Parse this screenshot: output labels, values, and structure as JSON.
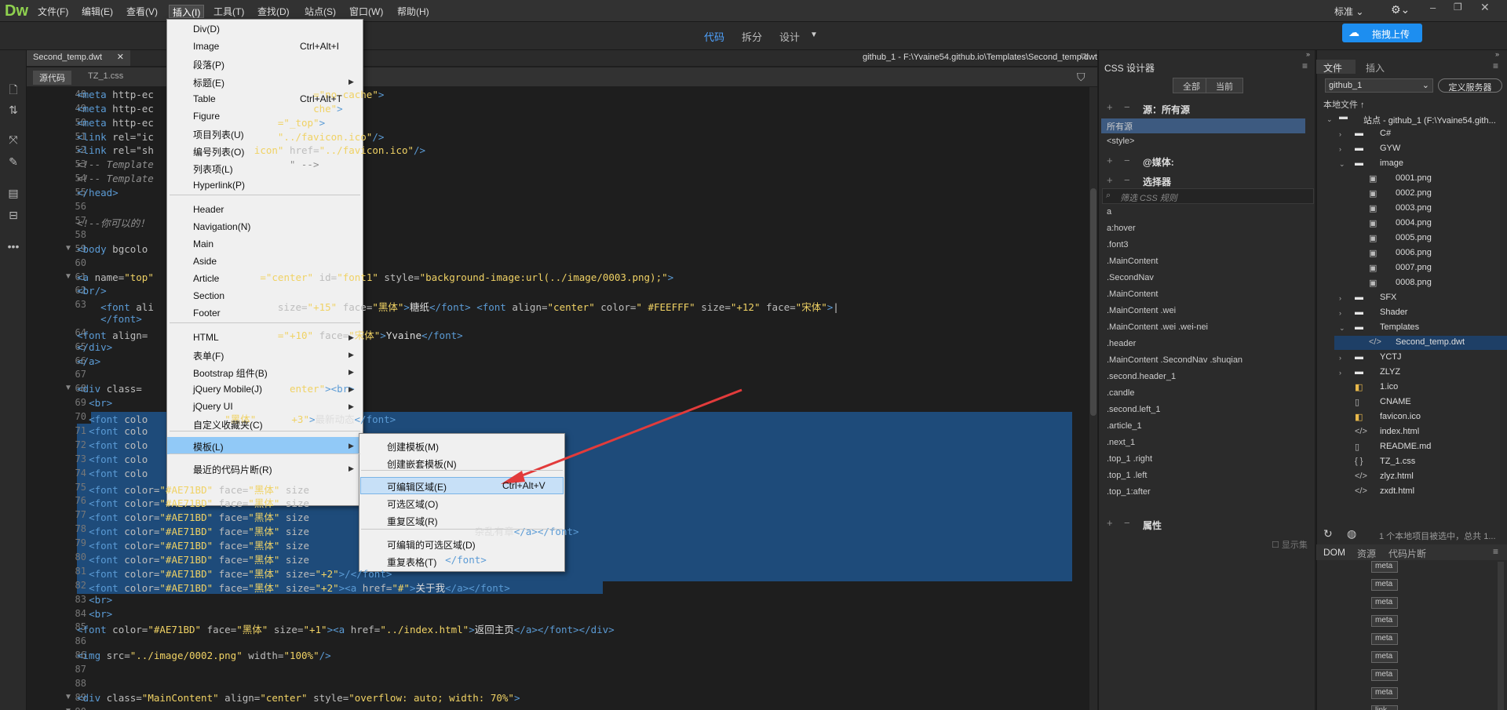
{
  "app": {
    "logo": "Dw",
    "standard": "标准",
    "upload": "拖拽上传"
  },
  "menubar": [
    "文件(F)",
    "编辑(E)",
    "查看(V)",
    "插入(I)",
    "工具(T)",
    "查找(D)",
    "站点(S)",
    "窗口(W)",
    "帮助(H)"
  ],
  "viewtabs": [
    "代码",
    "拆分",
    "设计"
  ],
  "doc": {
    "tab": "Second_temp.dwt",
    "path": "github_1 - F:\\Yvaine54.github.io\\Templates\\Second_temp.dwt",
    "subtabs": [
      "源代码",
      "TZ_1.css"
    ]
  },
  "code_lines": [
    {
      "n": "48",
      "fold": "",
      "html": "<span class=t>&lt;meta</span> <span class=a>http-ec</span><span class=a>                           </span><span class=s>=\"no-cache\"</span><span class=t>&gt;</span>"
    },
    {
      "n": "49",
      "fold": "",
      "html": "<span class=t>&lt;meta</span> <span class=a>http-ec</span><span class=a>                           </span><span class=s>che\"</span><span class=t>&gt;</span>"
    },
    {
      "n": "50",
      "fold": "",
      "html": "<span class=t>&lt;meta</span> <span class=a>http-ec</span><span class=a>                     </span><span class=s>=\"_top\"</span><span class=t>&gt;</span>"
    },
    {
      "n": "51",
      "fold": "",
      "html": "<span class=t>&lt;link</span> <span class=a>rel=\"ic</span><span class=a>                     </span><span class=s>\"../favicon.ico\"</span><span class=t>/&gt;</span>"
    },
    {
      "n": "52",
      "fold": "",
      "html": "<span class=t>&lt;link</span> <span class=a>rel=\"sh</span><span class=a>                 </span><span class=s>icon\"</span> <span class=a>href=</span><span class=s>\"../favicon.ico\"</span><span class=t>/&gt;</span>"
    },
    {
      "n": "53",
      "fold": "",
      "html": "<span class=c>&lt;!-- Template</span><span class=c>                       \" --&gt;</span>"
    },
    {
      "n": "54",
      "fold": "",
      "html": "<span class=c>&lt;!-- Template</span>"
    },
    {
      "n": "55",
      "fold": "",
      "html": "<span class=t>&lt;/head&gt;</span>"
    },
    {
      "n": "56",
      "fold": "",
      "html": ""
    },
    {
      "n": "57",
      "fold": "",
      "html": "<span class=c>&lt;!--你可以的！</span>"
    },
    {
      "n": "58",
      "fold": "",
      "html": ""
    },
    {
      "n": "59",
      "fold": "▼",
      "html": "<span class=t>&lt;body</span> <span class=a>bgcolo</span>"
    },
    {
      "n": "60",
      "fold": "",
      "html": ""
    },
    {
      "n": "61",
      "fold": "▼",
      "html": "<span class=t>&lt;a</span> <span class=a>name=</span><span class=s>\"top\"</span><span class=a>                  </span><span class=s>=\"center\"</span> <span class=a>id=</span><span class=s>\"font1\"</span> <span class=a>style=</span><span class=s>\"background-image:url(../image/0003.png);\"</span><span class=t>&gt;</span>"
    },
    {
      "n": "62",
      "fold": "",
      "html": "<span class=t>&lt;br/&gt;</span>"
    },
    {
      "n": "63",
      "fold": "",
      "html": "    <span class=t>&lt;font</span> <span class=a>ali</span><span class=a>                     </span><span class=a>size=</span><span class=s>\"+15\"</span> <span class=a>face=</span><span class=s>\"黑体\"</span><span class=t>&gt;</span><span class=w>糖纸</span><span class=t>&lt;/font&gt;</span> <span class=t>&lt;font</span> <span class=a>align=</span><span class=s>\"center\"</span> <span class=a>color=</span><span class=s>\" #FEEFFF\"</span> <span class=a>size=</span><span class=s>\"+12\"</span> <span class=a>face=</span><span class=s>\"宋体\"</span><span class=t>&gt;</span>|"
    },
    {
      "n": "",
      "fold": "",
      "html": "    <span class=t>&lt;/font&gt;</span>"
    },
    {
      "n": "64",
      "fold": "",
      "html": "<span class=t>&lt;font</span> <span class=a>align=</span><span class=a>                      </span><span class=s>=\"+10\"</span> <span class=a>face=</span><span class=s>\"宋体\"</span><span class=t>&gt;</span><span class=w>Yvaine</span><span class=t>&lt;/font&gt;</span>"
    },
    {
      "n": "65",
      "fold": "",
      "html": "<span class=t>&lt;/div&gt;</span>"
    },
    {
      "n": "66",
      "fold": "",
      "html": "<span class=t>&lt;/a&gt;</span>"
    },
    {
      "n": "67",
      "fold": "",
      "html": ""
    },
    {
      "n": "68",
      "fold": "▼",
      "html": "<span class=t>&lt;div</span> <span class=a>class=</span><span class=a>                         </span><span class=s>enter\"</span><span class=t>&gt;&lt;br&gt;</span>"
    },
    {
      "n": "69",
      "fold": "",
      "html": "  <span class=t>&lt;br&gt;</span>"
    },
    {
      "n": "70",
      "fold": "",
      "html": "  <span class=t>&lt;font</span> <span class=a>colo</span><span class=a>             </span><span class=s>\"黑体\"</span><span class=a>      </span><span class=s>+3\"</span><span class=t>&gt;</span><span class=w>最新动态</span><span class=t>&lt;/font&gt;</span>"
    },
    {
      "n": "71",
      "fold": "",
      "html": "  <span class=t>&lt;font</span> <span class=a>colo</span>"
    },
    {
      "n": "72",
      "fold": "",
      "html": "  <span class=t>&lt;font</span> <span class=a>colo</span>"
    },
    {
      "n": "73",
      "fold": "",
      "html": "  <span class=t>&lt;font</span> <span class=a>colo</span>"
    },
    {
      "n": "74",
      "fold": "",
      "html": "  <span class=t>&lt;font</span> <span class=a>colo</span>"
    },
    {
      "n": "75",
      "fold": "",
      "html": "  <span class=t>&lt;font</span> <span class=a>color=</span><span class=s>\"#AE71BD\"</span> <span class=a>face=</span><span class=s>\"黑体\"</span> <span class=a>size</span>"
    },
    {
      "n": "76",
      "fold": "",
      "html": "  <span class=t>&lt;font</span> <span class=a>color=</span><span class=s>\"#AE71BD\"</span> <span class=a>face=</span><span class=s>\"黑体\"</span> <span class=a>size</span>"
    },
    {
      "n": "77",
      "fold": "",
      "html": "  <span class=t>&lt;font</span> <span class=a>color=</span><span class=s>\"#AE71BD\"</span> <span class=a>face=</span><span class=s>\"黑体\"</span> <span class=a>size</span>"
    },
    {
      "n": "78",
      "fold": "",
      "html": "  <span class=t>&lt;font</span> <span class=a>color=</span><span class=s>\"#AE71BD\"</span> <span class=a>face=</span><span class=s>\"黑体\"</span> <span class=a>size</span><span class=a>                            </span><span class=w>杂乱有章</span><span class=t>&lt;/a&gt;&lt;/font&gt;</span>"
    },
    {
      "n": "79",
      "fold": "",
      "html": "  <span class=t>&lt;font</span> <span class=a>color=</span><span class=s>\"#AE71BD\"</span> <span class=a>face=</span><span class=s>\"黑体\"</span> <span class=a>size</span>"
    },
    {
      "n": "80",
      "fold": "",
      "html": "  <span class=t>&lt;font</span> <span class=a>color=</span><span class=s>\"#AE71BD\"</span> <span class=a>face=</span><span class=s>\"黑体\"</span> <span class=a>size</span><span class=a>                       </span><span class=t>&lt;/font&gt;</span>"
    },
    {
      "n": "81",
      "fold": "",
      "html": "  <span class=t>&lt;font</span> <span class=a>color=</span><span class=s>\"#AE71BD\"</span> <span class=a>face=</span><span class=s>\"黑体\"</span> <span class=a>size=</span><span class=s>\"+2\"</span><span class=t>&gt;/&lt;/font&gt;</span>"
    },
    {
      "n": "82",
      "fold": "",
      "html": "  <span class=t>&lt;font</span> <span class=a>color=</span><span class=s>\"#AE71BD\"</span> <span class=a>face=</span><span class=s>\"黑体\"</span> <span class=a>size=</span><span class=s>\"+2\"</span><span class=t>&gt;&lt;a</span> <span class=a>href=</span><span class=s>\"#\"</span><span class=t>&gt;</span><span class=w>关于我</span><span class=t>&lt;/a&gt;&lt;/font&gt;</span>"
    },
    {
      "n": "83",
      "fold": "",
      "html": "  <span class=t>&lt;br&gt;</span>"
    },
    {
      "n": "84",
      "fold": "",
      "html": "  <span class=t>&lt;br&gt;</span>"
    },
    {
      "n": "85",
      "fold": "",
      "html": "<span class=t>&lt;font</span> <span class=a>color=</span><span class=s>\"#AE71BD\"</span> <span class=a>face=</span><span class=s>\"黑体\"</span> <span class=a>size=</span><span class=s>\"+1\"</span><span class=t>&gt;&lt;a</span> <span class=a>href=</span><span class=s>\"../index.html\"</span><span class=t>&gt;</span><span class=w>返回主页</span><span class=t>&lt;/a&gt;&lt;/font&gt;&lt;/div&gt;</span>"
    },
    {
      "n": "86",
      "fold": "",
      "html": ""
    },
    {
      "n": "86",
      "fold": "",
      "html": "<span class=t>&lt;img</span> <span class=a>src=</span><span class=s>\"../image/0002.png\"</span> <span class=a>width=</span><span class=s>\"100%\"</span><span class=t>/&gt;</span>"
    },
    {
      "n": "87",
      "fold": "",
      "html": ""
    },
    {
      "n": "88",
      "fold": "",
      "html": ""
    },
    {
      "n": "89",
      "fold": "▼",
      "html": "<span class=t>&lt;div</span> <span class=a>class=</span><span class=s>\"MainContent\"</span> <span class=a>align=</span><span class=s>\"center\"</span> <span class=a>style=</span><span class=s>\"overflow: auto; width: 70%\"</span><span class=t>&gt;</span>"
    },
    {
      "n": "90",
      "fold": "▼",
      "html": ""
    }
  ],
  "insert_menu": [
    {
      "label": "Div(D)"
    },
    {
      "label": "Image",
      "shortcut": "Ctrl+Alt+I"
    },
    {
      "label": "段落(P)"
    },
    {
      "label": "标题(E)",
      "sub": true
    },
    {
      "label": "Table",
      "shortcut": "Ctrl+Alt+T"
    },
    {
      "label": "Figure"
    },
    {
      "label": "项目列表(U)"
    },
    {
      "label": "编号列表(O)"
    },
    {
      "label": "列表项(L)"
    },
    {
      "label": "Hyperlink(P)"
    },
    {
      "label": "Header"
    },
    {
      "label": "Navigation(N)"
    },
    {
      "label": "Main"
    },
    {
      "label": "Aside"
    },
    {
      "label": "Article"
    },
    {
      "label": "Section"
    },
    {
      "label": "Footer"
    },
    {
      "label": "HTML",
      "sub": true
    },
    {
      "label": "表单(F)",
      "sub": true
    },
    {
      "label": "Bootstrap 组件(B)",
      "sub": true
    },
    {
      "label": "jQuery Mobile(J)",
      "sub": true
    },
    {
      "label": "jQuery UI",
      "sub": true
    },
    {
      "label": "自定义收藏夹(C)"
    },
    {
      "label": "模板(L)",
      "sub": true
    },
    {
      "label": "最近的代码片断(R)",
      "sub": true
    }
  ],
  "template_submenu": [
    {
      "label": "创建模板(M)"
    },
    {
      "label": "创建嵌套模板(N)"
    },
    {
      "label": "可编辑区域(E)",
      "shortcut": "Ctrl+Alt+V"
    },
    {
      "label": "可选区域(O)"
    },
    {
      "label": "重复区域(R)"
    },
    {
      "label": "可编辑的可选区域(D)"
    },
    {
      "label": "重复表格(T)"
    }
  ],
  "css_designer": {
    "title": "CSS 设计器",
    "btn_all": "全部",
    "btn_current": "当前",
    "sources_label": "源：所有源",
    "source_items": [
      "所有源",
      "<style>"
    ],
    "media_label": "@媒体:",
    "selectors_label": "选择器",
    "filter_placeholder": "筛选 CSS 规则",
    "selectors": [
      "a",
      "a:hover",
      ".font3",
      ".MainContent",
      ".SecondNav",
      ".MainContent",
      ".MainContent .wei",
      ".MainContent .wei .wei-nei",
      ".header",
      ".MainContent .SecondNav .shuqian",
      ".second.header_1",
      ".candle",
      ".second.left_1",
      ".article_1",
      ".next_1",
      ".top_1 .right",
      ".top_1 .left",
      ".top_1:after"
    ],
    "properties_label": "属性",
    "show_set": "显示集"
  },
  "files": {
    "tabs": [
      "文件",
      "插入"
    ],
    "site": "github_1",
    "define_server": "定义服务器",
    "local_files": "本地文件 ↑",
    "root": "站点 - github_1 (F:\\Yvaine54.gith...",
    "tree": [
      {
        "name": "C#",
        "type": "folder",
        "level": 1,
        "caret": "›"
      },
      {
        "name": "GYW",
        "type": "folder",
        "level": 1,
        "caret": "›"
      },
      {
        "name": "image",
        "type": "folder",
        "level": 1,
        "caret": "⌄"
      },
      {
        "name": "0001.png",
        "type": "img",
        "level": 2
      },
      {
        "name": "0002.png",
        "type": "img",
        "level": 2
      },
      {
        "name": "0003.png",
        "type": "img",
        "level": 2
      },
      {
        "name": "0004.png",
        "type": "img",
        "level": 2
      },
      {
        "name": "0005.png",
        "type": "img",
        "level": 2
      },
      {
        "name": "0006.png",
        "type": "img",
        "level": 2
      },
      {
        "name": "0007.png",
        "type": "img",
        "level": 2
      },
      {
        "name": "0008.png",
        "type": "img",
        "level": 2
      },
      {
        "name": "SFX",
        "type": "folder",
        "level": 1,
        "caret": "›"
      },
      {
        "name": "Shader",
        "type": "folder",
        "level": 1,
        "caret": "›"
      },
      {
        "name": "Templates",
        "type": "folder",
        "level": 1,
        "caret": "⌄"
      },
      {
        "name": "Second_temp.dwt",
        "type": "code",
        "level": 2
      },
      {
        "name": "YCTJ",
        "type": "folder",
        "level": 1,
        "caret": "›"
      },
      {
        "name": "ZLYZ",
        "type": "folder",
        "level": 1,
        "caret": "›"
      },
      {
        "name": "1.ico",
        "type": "ico",
        "level": 1
      },
      {
        "name": "CNAME",
        "type": "doc",
        "level": 1
      },
      {
        "name": "favicon.ico",
        "type": "ico",
        "level": 1
      },
      {
        "name": "index.html",
        "type": "code",
        "level": 1
      },
      {
        "name": "README.md",
        "type": "doc",
        "level": 1
      },
      {
        "name": "TZ_1.css",
        "type": "css",
        "level": 1
      },
      {
        "name": "zlyz.html",
        "type": "code",
        "level": 1
      },
      {
        "name": "zxdt.html",
        "type": "code",
        "level": 1
      }
    ],
    "status": "1 个本地项目被选中，总共 1...",
    "dom_tabs": [
      "DOM",
      "资源",
      "代码片断"
    ],
    "dom_items": [
      "meta",
      "meta",
      "meta",
      "meta",
      "meta",
      "meta",
      "meta",
      "meta",
      "link"
    ]
  }
}
